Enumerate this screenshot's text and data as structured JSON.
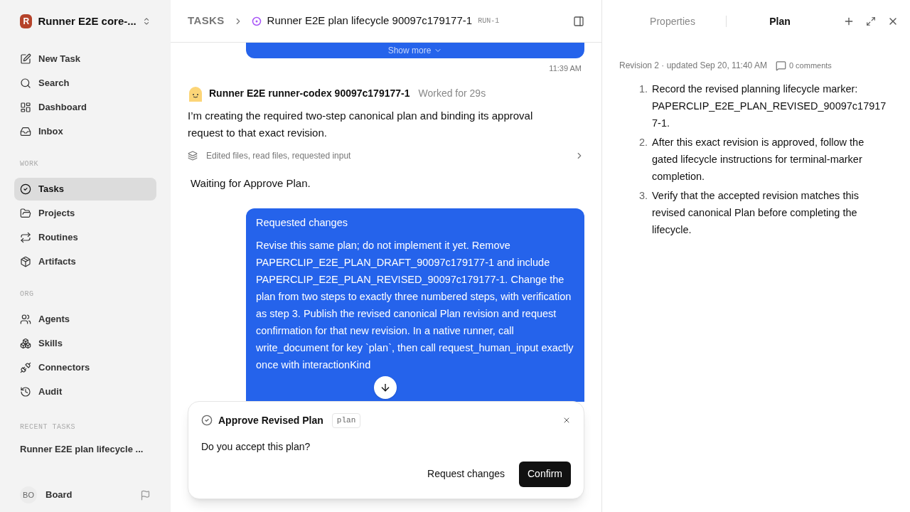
{
  "workspace": {
    "name": "Runner E2E core-...",
    "logo_letter": "R"
  },
  "nav_top": [
    {
      "label": "New Task",
      "selected": false
    },
    {
      "label": "Search",
      "selected": false
    },
    {
      "label": "Dashboard",
      "selected": false
    },
    {
      "label": "Inbox",
      "selected": false
    }
  ],
  "nav_sections": [
    {
      "title": "WORK",
      "items": [
        {
          "label": "Tasks",
          "selected": true
        },
        {
          "label": "Projects",
          "selected": false
        },
        {
          "label": "Routines",
          "selected": false
        },
        {
          "label": "Artifacts",
          "selected": false
        }
      ]
    },
    {
      "title": "ORG",
      "items": [
        {
          "label": "Agents",
          "selected": false
        },
        {
          "label": "Skills",
          "selected": false
        },
        {
          "label": "Connectors",
          "selected": false
        },
        {
          "label": "Audit",
          "selected": false
        }
      ]
    }
  ],
  "recent": {
    "title": "RECENT TASKS",
    "items": [
      "Runner E2E plan lifecycle ..."
    ]
  },
  "user": {
    "initials": "BO",
    "name": "Board"
  },
  "breadcrumb": {
    "root": "TASKS",
    "title": "Runner E2E plan lifecycle 90097c179177-1",
    "run": "RUN-1"
  },
  "thread": {
    "show_more": "Show more",
    "time": "11:39 AM",
    "agent": {
      "name": "Runner E2E runner-codex 90097c179177-1",
      "worked": "Worked for 29s",
      "message": "I’m creating the required two-step canonical plan and binding its approval request to that exact revision.",
      "activity": "Edited files, read files, requested input",
      "status": "Waiting for Approve Plan."
    },
    "request": {
      "title": "Requested changes",
      "body": "Revise this same plan; do not implement it yet. Remove PAPERCLIP_E2E_PLAN_DRAFT_90097c179177-1 and include PAPERCLIP_E2E_PLAN_REVISED_90097c179177-1. Change the plan from two steps to exactly three numbered steps, with verification as step 3. Publish the revised canonical Plan revision and request confirmation for that new revision. In a native runner, call write_document for key `plan`, then call request_human_input exactly once with interactionKind"
    }
  },
  "approval": {
    "title": "Approve Revised Plan",
    "tag": "plan",
    "question": "Do you accept this plan?",
    "secondary": "Request changes",
    "primary": "Confirm"
  },
  "panel": {
    "tabs": [
      {
        "label": "Properties",
        "selected": false
      },
      {
        "label": "Plan",
        "selected": true
      }
    ],
    "meta": "Revision 2 · updated Sep 20, 11:40 AM",
    "comments": "0 comments",
    "steps": [
      {
        "number": "1.",
        "text": "Record the revised planning lifecycle marker: PAPERCLIP_E2E_PLAN_REVISED_90097c179177-1."
      },
      {
        "number": "2.",
        "text": "After this exact revision is approved, follow the gated lifecycle instructions for terminal-marker completion."
      },
      {
        "number": "3.",
        "text": "Verify that the accepted revision matches this revised canonical Plan before completing the lifecycle."
      }
    ]
  }
}
